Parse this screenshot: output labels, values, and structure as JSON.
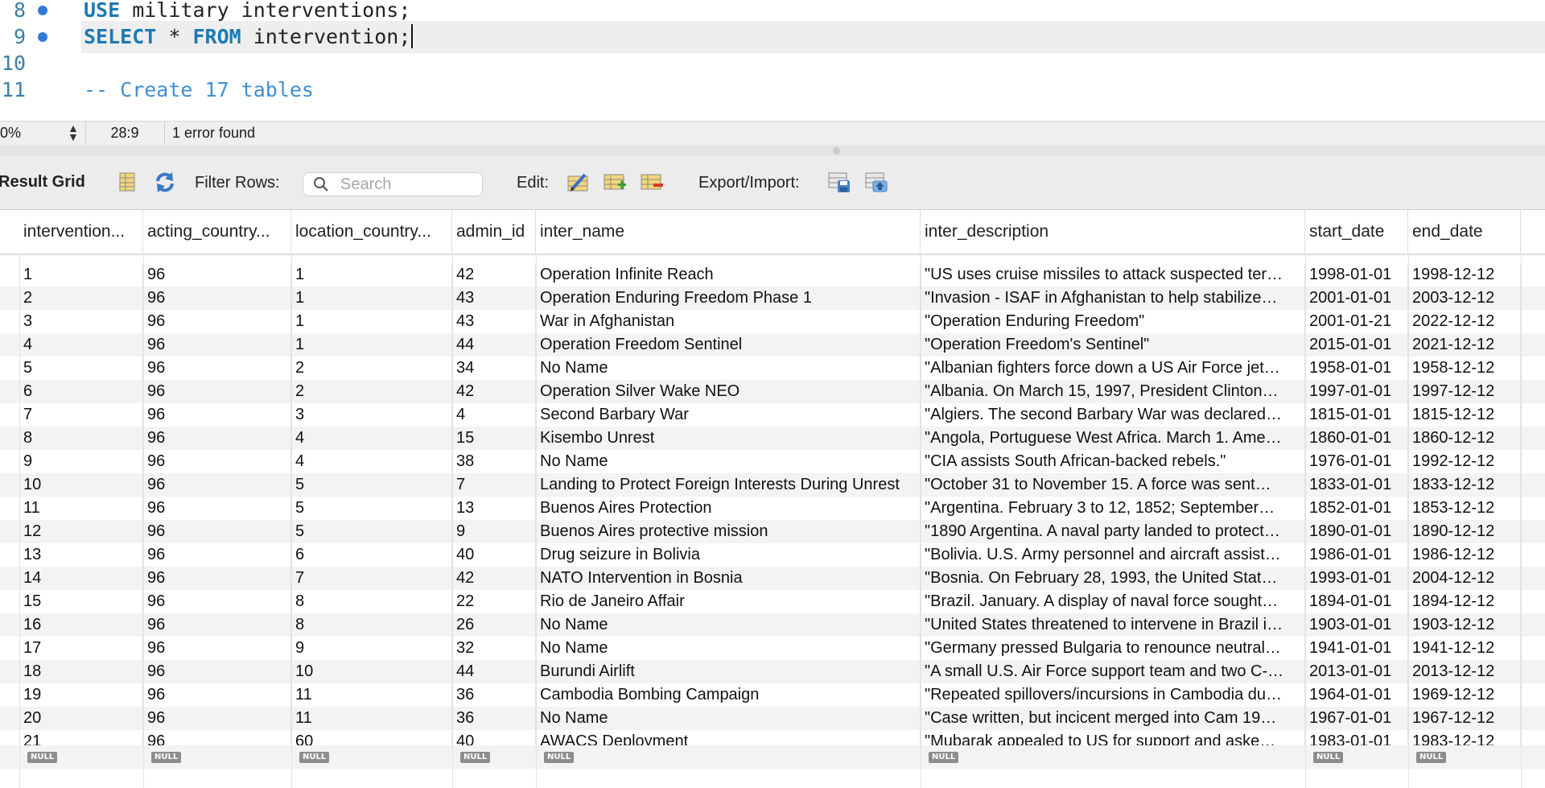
{
  "editor": {
    "lines": [
      {
        "number": "8",
        "breakpoint": true,
        "keyword": "USE",
        "text": " military_interventions;",
        "current": false
      },
      {
        "number": "9",
        "breakpoint": true,
        "keyword": "SELECT",
        "text": " * ",
        "keyword2": "FROM",
        "text2": " intervention;",
        "current": true
      },
      {
        "number": "10",
        "breakpoint": false,
        "text": ""
      },
      {
        "number": "11",
        "breakpoint": false,
        "comment": "-- Create 17 tables"
      }
    ]
  },
  "status": {
    "zoom": "0%",
    "cursor_position": "28:9",
    "message": "1 error found"
  },
  "toolbar": {
    "title": "Result Grid",
    "filter_label": "Filter Rows:",
    "search_placeholder": "Search",
    "edit_label": "Edit:",
    "export_label": "Export/Import:"
  },
  "grid": {
    "columns": [
      "intervention...",
      "acting_country...",
      "location_country...",
      "admin_id",
      "inter_name",
      "inter_description",
      "start_date",
      "end_date"
    ],
    "rows": [
      [
        "1",
        "96",
        "1",
        "42",
        "Operation Infinite Reach",
        "\"US uses cruise missiles to attack suspected ter…",
        "1998-01-01",
        "1998-12-12"
      ],
      [
        "2",
        "96",
        "1",
        "43",
        "Operation Enduring Freedom Phase 1",
        "\"Invasion - ISAF in Afghanistan to help stabilize…",
        "2001-01-01",
        "2003-12-12"
      ],
      [
        "3",
        "96",
        "1",
        "43",
        "War in Afghanistan",
        "\"Operation Enduring Freedom\"",
        "2001-01-21",
        "2022-12-12"
      ],
      [
        "4",
        "96",
        "1",
        "44",
        "Operation Freedom Sentinel",
        "\"Operation Freedom's Sentinel\"",
        "2015-01-01",
        "2021-12-12"
      ],
      [
        "5",
        "96",
        "2",
        "34",
        "No Name",
        "\"Albanian fighters force down a US Air Force jet…",
        "1958-01-01",
        "1958-12-12"
      ],
      [
        "6",
        "96",
        "2",
        "42",
        "Operation Silver Wake NEO",
        "\"Albania. On March 15, 1997, President Clinton…",
        "1997-01-01",
        "1997-12-12"
      ],
      [
        "7",
        "96",
        "3",
        "4",
        "Second Barbary War",
        "\"Algiers. The second Barbary War was declared…",
        "1815-01-01",
        "1815-12-12"
      ],
      [
        "8",
        "96",
        "4",
        "15",
        "Kisembo Unrest",
        "\"Angola, Portuguese West Africa. March 1. Ame…",
        "1860-01-01",
        "1860-12-12"
      ],
      [
        "9",
        "96",
        "4",
        "38",
        "No Name",
        "\"CIA assists South African-backed rebels.\"",
        "1976-01-01",
        "1992-12-12"
      ],
      [
        "10",
        "96",
        "5",
        "7",
        "Landing to Protect Foreign Interests During Unrest",
        "\"October 31 to November 15. A force was sent…",
        "1833-01-01",
        "1833-12-12"
      ],
      [
        "11",
        "96",
        "5",
        "13",
        "Buenos Aires Protection",
        "\"Argentina. February 3 to 12, 1852; September…",
        "1852-01-01",
        "1853-12-12"
      ],
      [
        "12",
        "96",
        "5",
        "9",
        "Buenos Aires protective mission",
        "\"1890 Argentina. A naval party landed to protect…",
        "1890-01-01",
        "1890-12-12"
      ],
      [
        "13",
        "96",
        "6",
        "40",
        "Drug seizure in Bolivia",
        "\"Bolivia. U.S. Army personnel and aircraft assist…",
        "1986-01-01",
        "1986-12-12"
      ],
      [
        "14",
        "96",
        "7",
        "42",
        "NATO Intervention in Bosnia",
        "\"Bosnia. On February 28, 1993, the United Stat…",
        "1993-01-01",
        "2004-12-12"
      ],
      [
        "15",
        "96",
        "8",
        "22",
        "Rio de Janeiro Affair",
        "\"Brazil. January. A display of naval force sought…",
        "1894-01-01",
        "1894-12-12"
      ],
      [
        "16",
        "96",
        "8",
        "26",
        "No Name",
        "\"United States threatened to intervene in Brazil i…",
        "1903-01-01",
        "1903-12-12"
      ],
      [
        "17",
        "96",
        "9",
        "32",
        "No Name",
        "\"Germany pressed Bulgaria to renounce neutral…",
        "1941-01-01",
        "1941-12-12"
      ],
      [
        "18",
        "96",
        "10",
        "44",
        "Burundi Airlift",
        "\"A small U.S. Air Force support team and two C-…",
        "2013-01-01",
        "2013-12-12"
      ],
      [
        "19",
        "96",
        "11",
        "36",
        "Cambodia Bombing Campaign",
        "\"Repeated spillovers/incursions in Cambodia du…",
        "1964-01-01",
        "1969-12-12"
      ],
      [
        "20",
        "96",
        "11",
        "36",
        "No Name",
        "\"Case written, but incicent merged into Cam 19…",
        "1967-01-01",
        "1967-12-12"
      ],
      [
        "21",
        "96",
        "60",
        "40",
        "AWACS Deployment",
        "\"Mubarak appealed to US for support and aske…",
        "1983-01-01",
        "1983-12-12"
      ]
    ],
    "null_label": "NULL"
  },
  "colors": {
    "keyword": "#1b7ab3",
    "comment": "#3f8fd0",
    "line_number": "#3a7fa8",
    "breakpoint": "#2f7bd6",
    "alt_row": "#f3f3f3",
    "null_badge": "#8d8d8d"
  },
  "icons": [
    "breakpoint-dot-icon",
    "stepper-icon",
    "form-editor-icon",
    "refresh-icon",
    "search-icon",
    "edit-row-icon",
    "add-row-icon",
    "delete-row-icon",
    "export-icon",
    "import-icon"
  ]
}
